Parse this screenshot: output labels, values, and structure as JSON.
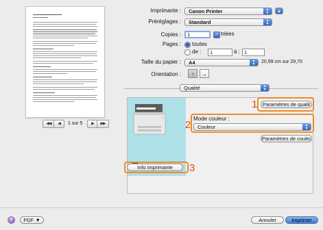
{
  "form": {
    "printer_label": "Imprimante :",
    "printer_value": "Canon Printer",
    "presets_label": "Préréglages :",
    "presets_value": "Standard",
    "copies_label": "Copies :",
    "copies_value": "1",
    "collated_label": "triées",
    "pages_label": "Pages :",
    "pages_all": "toutes",
    "pages_from": "de :",
    "pages_from_value": "1",
    "pages_to": "à :",
    "pages_to_value": "1",
    "paper_size_label": "Taille du papier :",
    "paper_size_value": "A4",
    "paper_dims": "20,99 cm sur 29,70",
    "orientation_label": "Orientation :",
    "section_value": "Qualité"
  },
  "preview": {
    "page_indicator": "1 sur 5"
  },
  "panel": {
    "quality_settings_button": "Paramètres de qualit",
    "color_mode_label": "Mode couleur :",
    "color_mode_value": "Couleur",
    "color_settings_button": "Paramètres de couleı",
    "printer_info_button": "Info imprimante"
  },
  "callouts": {
    "one": "1",
    "two": "2",
    "three": "3"
  },
  "footer": {
    "help": "?",
    "pdf_button": "PDF ▼",
    "cancel_button": "Annuler",
    "print_button": "Imprimer"
  }
}
